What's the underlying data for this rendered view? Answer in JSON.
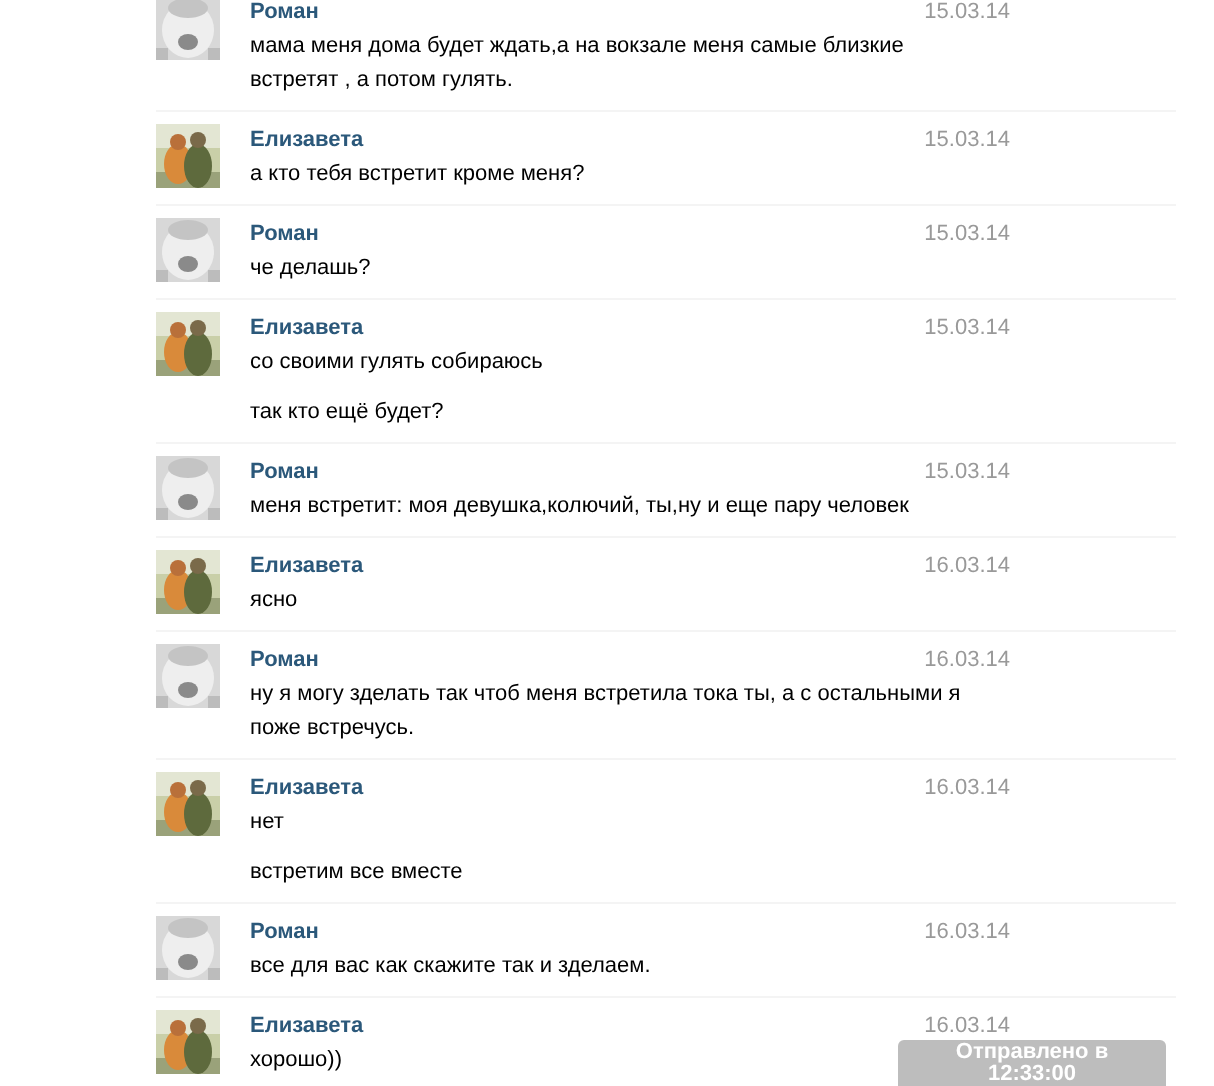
{
  "messages": [
    {
      "author": "Роман",
      "date": "15.03.14",
      "avatar": {
        "kind": "picture"
      },
      "texts": [
        "мама меня дома будет ждать,а на вокзале меня самые близкие встретят , а потом гулять."
      ]
    },
    {
      "author": "Елизавета",
      "date": "15.03.14",
      "avatar": {
        "kind": "picture"
      },
      "texts": [
        "а кто тебя встретит кроме меня?"
      ]
    },
    {
      "author": "Роман",
      "date": "15.03.14",
      "avatar": {
        "kind": "picture"
      },
      "texts": [
        "че делашь?"
      ]
    },
    {
      "author": "Елизавета",
      "date": "15.03.14",
      "avatar": {
        "kind": "picture"
      },
      "texts": [
        "со своими гулять собираюсь",
        "так кто ещё будет?"
      ]
    },
    {
      "author": "Роман",
      "date": "15.03.14",
      "avatar": {
        "kind": "picture"
      },
      "texts": [
        "меня встретит: моя девушка,колючий, ты,ну и еще пару человек"
      ]
    },
    {
      "author": "Елизавета",
      "date": "16.03.14",
      "avatar": {
        "kind": "picture"
      },
      "texts": [
        "ясно"
      ]
    },
    {
      "author": "Роман",
      "date": "16.03.14",
      "avatar": {
        "kind": "picture"
      },
      "texts": [
        "ну я могу зделать так чтоб меня встретила тока ты, а с остальными я поже встречусь."
      ]
    },
    {
      "author": "Елизавета",
      "date": "16.03.14",
      "avatar": {
        "kind": "picture"
      },
      "texts": [
        "нет",
        "встретим все вместе"
      ]
    },
    {
      "author": "Роман",
      "date": "16.03.14",
      "avatar": {
        "kind": "picture"
      },
      "texts": [
        "все для вас как скажите так и зделаем."
      ]
    },
    {
      "author": "Елизавета",
      "date": "16.03.14",
      "avatar": {
        "kind": "picture"
      },
      "texts": [
        "хорошо))"
      ]
    }
  ],
  "sent_notice": "Отправлено в 12:33:00"
}
